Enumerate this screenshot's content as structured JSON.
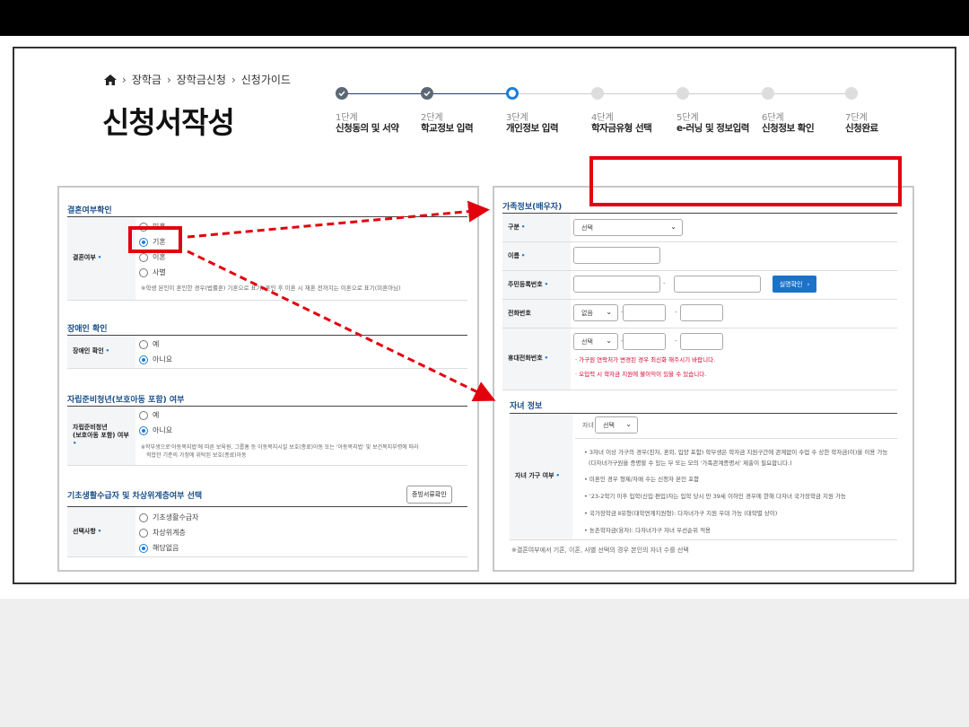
{
  "breadcrumb": [
    "장학금",
    "장학금신청",
    "신청가이드"
  ],
  "page_title": "신청서작성",
  "steps": [
    {
      "num": "1단계",
      "name": "신청동의 및 서약",
      "state": "done"
    },
    {
      "num": "2단계",
      "name": "학교정보 입력",
      "state": "done"
    },
    {
      "num": "3단계",
      "name": "개인정보 입력",
      "state": "current"
    },
    {
      "num": "4단계",
      "name": "학자금유형 선택",
      "state": "todo"
    },
    {
      "num": "5단계",
      "name": "e-러닝 및 정보입력",
      "state": "todo"
    },
    {
      "num": "6단계",
      "name": "신청정보 확인",
      "state": "todo"
    },
    {
      "num": "7단계",
      "name": "신청완료",
      "state": "todo"
    }
  ],
  "left": {
    "marriage": {
      "title": "결혼여부확인",
      "label": "결혼여부",
      "options": [
        "미혼",
        "기혼",
        "이혼",
        "사별"
      ],
      "selected": "기혼",
      "note": "※학생 본인이 혼인한 경우(법률혼) 기혼으로 표기, 혼인 후 이혼 시 재혼 전까지는 이혼으로 표기(미혼아님)"
    },
    "disability": {
      "title": "장애인 확인",
      "label": "장애인 확인",
      "options": [
        "예",
        "아니요"
      ],
      "selected": "아니요"
    },
    "independence": {
      "title": "자립준비청년(보호아동 포함) 여부",
      "label_lines": [
        "자립준비청년",
        "(보호아동 포함) 여부"
      ],
      "options": [
        "예",
        "아니요"
      ],
      "selected": "아니요",
      "note_lines": [
        "※학부생으로'아동복지법'에 따른 보육원, 그룹홈 등 아동복지시설 보호(종료)아동 또는 '아동복지법' 및 보건복지부령에 따라",
        "적합한 기준의 가정에 위탁된 보호(종료)아동"
      ]
    },
    "basic_living": {
      "title": "기초생활수급자 및 차상위계층여부 선택",
      "button": "증빙서류확인",
      "label": "선택사항",
      "options": [
        "기초생활수급자",
        "차상위계층",
        "해당없음"
      ],
      "selected": "해당없음"
    }
  },
  "right": {
    "family": {
      "title": "가족정보(배우자)",
      "rows": {
        "type": {
          "label": "구분",
          "select": "선택"
        },
        "name": {
          "label": "이름"
        },
        "rrn": {
          "label": "주민등록번호",
          "button": "실명확인",
          "dash": "-"
        },
        "phone": {
          "label": "전화번호",
          "select": "없음",
          "dash": "-"
        },
        "mobile": {
          "label": "휴대전화번호",
          "select": "선택",
          "dash": "-",
          "notes": [
            "가구원 연락처가 변경된 경우 최신화 해주시기 바랍니다.",
            "오입력 시 학자금 지원에 불이익이 있을 수 있습니다."
          ]
        }
      }
    },
    "children": {
      "title": "자녀 정보",
      "label": "자녀 가구 여부",
      "select_label": "자녀",
      "select_value": "선택",
      "bullets": [
        "3자녀 이상 가구의 경우(친자, 혼외, 입양 포함) 학부생은 학자금 지원구간에 관계없이 수업 수 상한 학자금(이)을 이용 가능",
        "(다자녀가구원을 증명할 수 있는 부 또는 모의 '가족관계증명서' 제출이 필요합니다.)",
        "미혼인 경우 형제/자매 수는 신청자 본인 포함",
        "'23-2학기 이후 입학(신입·편입)자는 입학 당시 만 39세 이하인 경우에 한해 다자녀 국가장학금 지원 가능",
        "국가장학금 Ⅱ유형(대학연계지원형): 다자녀가구 지원 우대 가능 (대학별 상이)",
        "농촌학자금(융자): 다자녀가구 자녀 우선순위 적용"
      ],
      "footnote": "※결혼여부에서 기혼, 이혼, 사별 선택의 경우 본인의 자녀 수를 선택"
    }
  },
  "colors": {
    "accent": "#1c7ed6",
    "highlight": "#e3000f",
    "section_title": "#1a4f8b"
  },
  "icons": [
    "home-icon",
    "check-icon",
    "chevron-down-icon",
    "chevron-right-icon"
  ]
}
